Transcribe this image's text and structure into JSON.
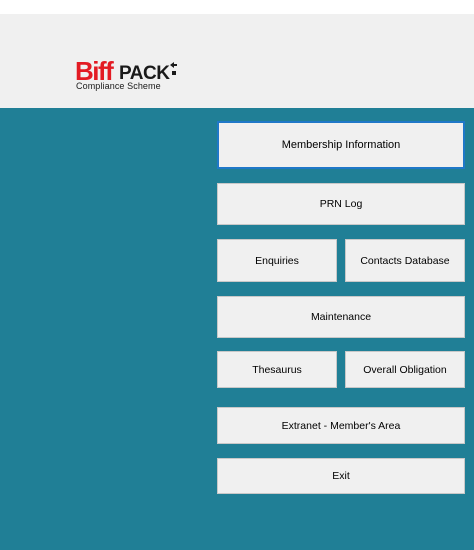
{
  "brand": {
    "logo_text": "BiffPack",
    "tagline": "Compliance Scheme",
    "colors": {
      "biff_red": "#e31b23",
      "pack_black": "#1a1a1a",
      "header_bg": "#f0f0f0",
      "main_bg": "#207f96",
      "focus_border": "#1f78c8"
    }
  },
  "menu": {
    "membership_information": "Membership Information",
    "prn_log": "PRN Log",
    "enquiries": "Enquiries",
    "contacts_database": "Contacts Database",
    "maintenance": "Maintenance",
    "thesaurus": "Thesaurus",
    "overall_obligation": "Overall Obligation",
    "extranet": "Extranet - Member's Area",
    "exit": "Exit"
  }
}
